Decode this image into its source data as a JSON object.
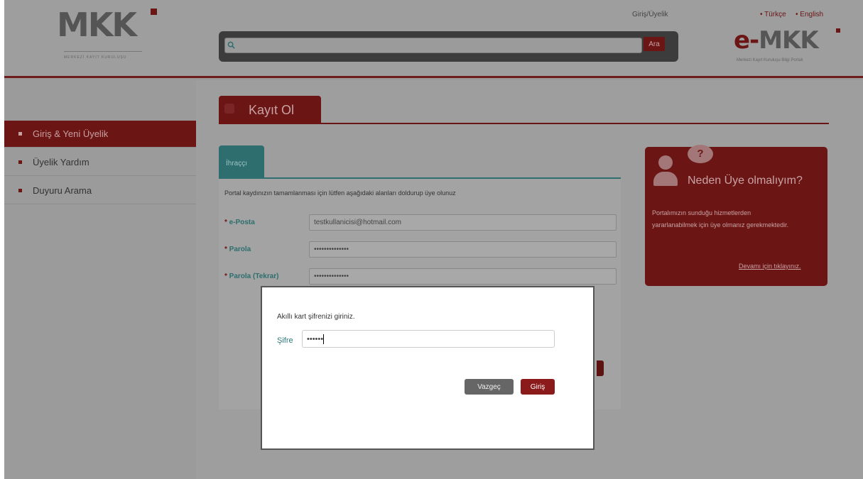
{
  "header": {
    "logo_text": "MKK",
    "logo_subtitle": "MERKEZİ KAYIT KURULUŞU",
    "search": {
      "value": "",
      "button_label": "Ara"
    },
    "login_link": "Giriş/Üyelik",
    "languages": [
      "• Türkçe",
      "• English"
    ],
    "portal_logo_prefix": "e-",
    "portal_logo_text": "MKK",
    "portal_logo_subtitle": "Merkezi Kayıt Kuruluşu Bilgi Portalı"
  },
  "sidebar": {
    "items": [
      {
        "label": "Giriş & Yeni Üyelik",
        "active": true
      },
      {
        "label": "Üyelik Yardım",
        "active": false
      },
      {
        "label": "Duyuru Arama",
        "active": false
      }
    ]
  },
  "main": {
    "page_title": "Kayıt Ol",
    "tab_label": "İhraççı",
    "intro": "Portal kaydınızın tamamlanması için lütfen aşağıdaki alanları doldurup üye olunuz",
    "fields": [
      {
        "label": "e-Posta",
        "value": "testkullanicisi@hotmail.com"
      },
      {
        "label": "Parola",
        "value": "••••••••••••••"
      },
      {
        "label": "Parola (Tekrar)",
        "value": "••••••••••••••"
      }
    ]
  },
  "info_box": {
    "title": "Neden Üye olmalıyım?",
    "text": "Portalımızın sunduğu hizmetlerden yararlanabilmek için üye olmanız gerekmektedir.",
    "link": "Devamı için tıklayınız."
  },
  "modal": {
    "prompt": "Akıllı kart şifrenizi giriniz.",
    "field_label": "Şifre",
    "field_value": "••••••",
    "cancel_label": "Vazgeç",
    "ok_label": "Giriş"
  },
  "colors": {
    "brand": "#6b1515",
    "teal": "#2e6e6e",
    "overlay": "#9e9e9e"
  }
}
